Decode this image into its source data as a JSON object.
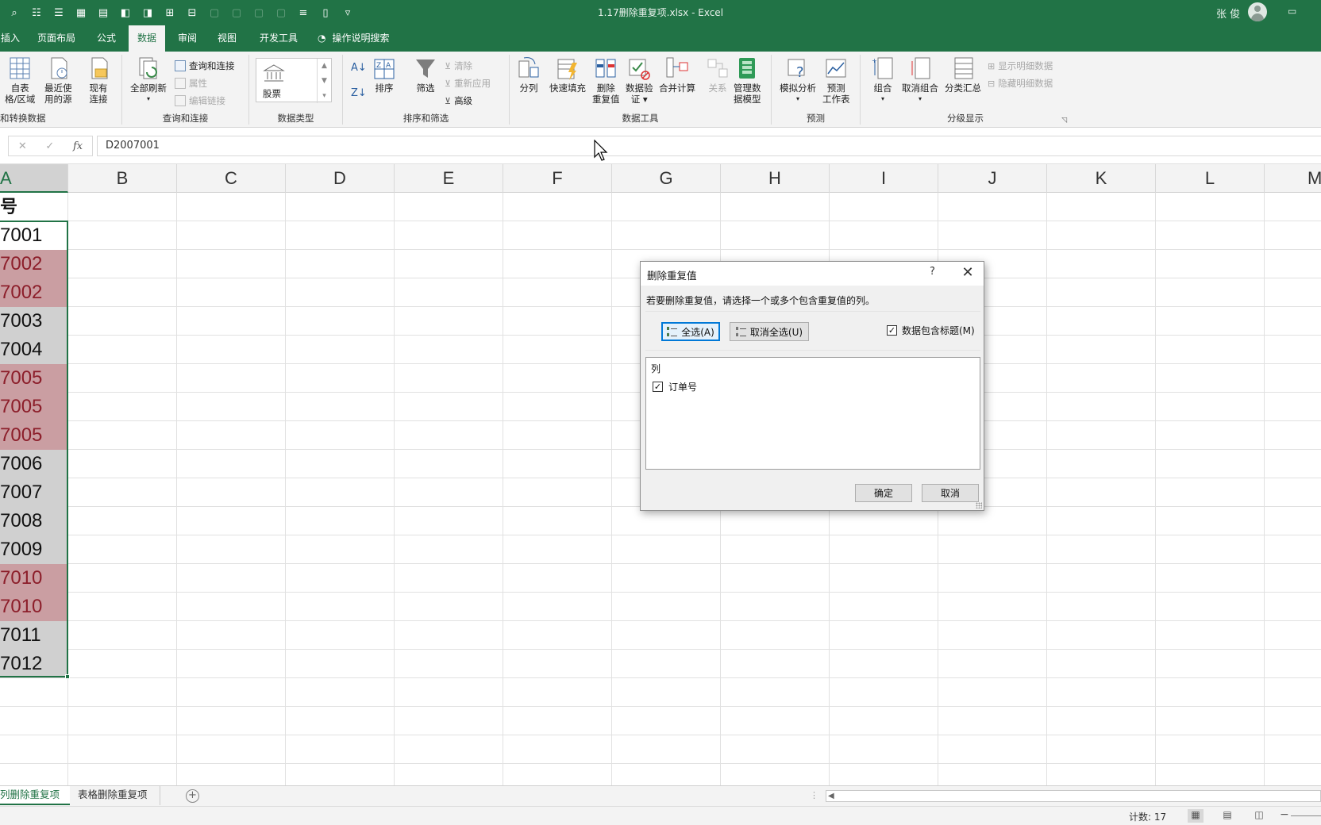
{
  "app": {
    "document_title": "1.17删除重复项.xlsx  -  Excel",
    "user_name": "张 俊"
  },
  "tabs": [
    {
      "label": "插入"
    },
    {
      "label": "页面布局"
    },
    {
      "label": "公式"
    },
    {
      "label": "数据"
    },
    {
      "label": "审阅"
    },
    {
      "label": "视图"
    },
    {
      "label": "开发工具"
    }
  ],
  "tell_me": "操作说明搜索",
  "ribbon": {
    "get_transform": {
      "label": "和转换数据",
      "from_table": "自表\n格/区域",
      "recent_sources": "最近使\n用的源",
      "existing_connections": "现有\n连接"
    },
    "queries": {
      "label": "查询和连接",
      "refresh_all": "全部刷新",
      "queries_connections": "查询和连接",
      "properties": "属性",
      "edit_links": "编辑链接"
    },
    "data_types": {
      "label": "数据类型",
      "stocks": "股票"
    },
    "sort_filter": {
      "label": "排序和筛选",
      "sort": "排序",
      "filter": "筛选",
      "clear": "清除",
      "reapply": "重新应用",
      "advanced": "高级"
    },
    "data_tools": {
      "label": "数据工具",
      "text_to_columns": "分列",
      "flash_fill": "快速填充",
      "remove_duplicates": "删除\n重复值",
      "data_validation": "数据验\n证 ▾",
      "consolidate": "合并计算",
      "relationships": "关系",
      "manage_data_model": "管理数\n据模型"
    },
    "forecast": {
      "label": "预测",
      "what_if": "模拟分析",
      "forecast_sheet": "预测\n工作表"
    },
    "outline": {
      "label": "分级显示",
      "group": "组合",
      "ungroup": "取消组合",
      "subtotal": "分类汇总",
      "show_detail": "显示明细数据",
      "hide_detail": "隐藏明细数据"
    }
  },
  "formula_bar": {
    "cancel": "✕",
    "enter": "✓",
    "fx": "fx",
    "value": "D2007001"
  },
  "columns": [
    "A",
    "B",
    "C",
    "D",
    "E",
    "F",
    "G",
    "H",
    "I",
    "J",
    "K",
    "L",
    "M"
  ],
  "column_a": [
    {
      "text": "号",
      "state": "header"
    },
    {
      "text": "7001",
      "state": "first"
    },
    {
      "text": "7002",
      "state": "dup"
    },
    {
      "text": "7002",
      "state": "dup"
    },
    {
      "text": "7003",
      "state": "sel"
    },
    {
      "text": "7004",
      "state": "sel"
    },
    {
      "text": "7005",
      "state": "dup"
    },
    {
      "text": "7005",
      "state": "dup"
    },
    {
      "text": "7005",
      "state": "dup"
    },
    {
      "text": "7006",
      "state": "sel"
    },
    {
      "text": "7007",
      "state": "sel"
    },
    {
      "text": "7008",
      "state": "sel"
    },
    {
      "text": "7009",
      "state": "sel"
    },
    {
      "text": "7010",
      "state": "dup"
    },
    {
      "text": "7010",
      "state": "dup"
    },
    {
      "text": "7011",
      "state": "sel"
    },
    {
      "text": "7012",
      "state": "sel"
    }
  ],
  "sheets": [
    {
      "label": "列删除重复项",
      "active": true
    },
    {
      "label": "表格删除重复项",
      "active": false
    }
  ],
  "status": {
    "count": "计数: 17"
  },
  "dialog": {
    "title": "删除重复值",
    "help": "?",
    "close": "✕",
    "instruction": "若要删除重复值，请选择一个或多个包含重复值的列。",
    "select_all": "全选(A)",
    "unselect_all": "取消全选(U)",
    "has_headers": "数据包含标题(M)",
    "list_header": "列",
    "column_item": "订单号",
    "ok": "确定",
    "cancel": "取消"
  },
  "colors": {
    "brand": "#217346",
    "duplicate_fill": "#ca9ea2",
    "duplicate_text": "#8c1e2a"
  }
}
